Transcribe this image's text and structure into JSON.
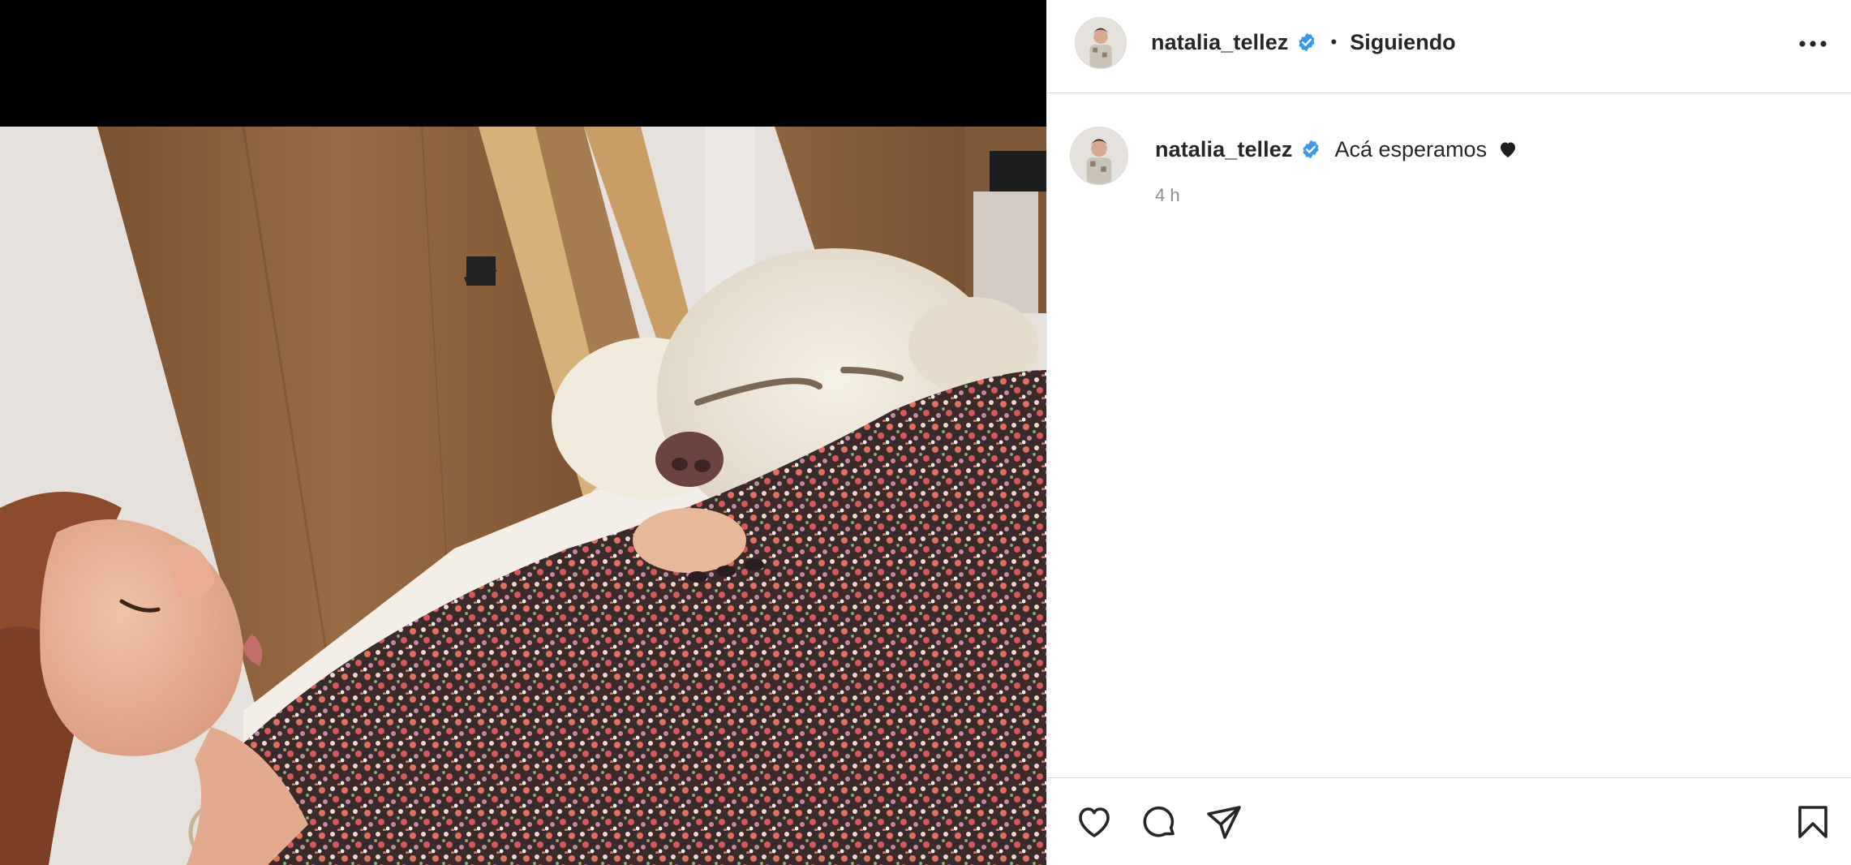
{
  "post": {
    "media": {
      "description_icon": "photo"
    }
  },
  "header": {
    "username": "natalia_tellez",
    "separator": "•",
    "follow_status": "Siguiendo",
    "more_icon": "more-horizontal-icon"
  },
  "caption": {
    "username": "natalia_tellez",
    "text": "Acá esperamos",
    "emoji": "black-heart",
    "timestamp": "4 h"
  },
  "actions": {
    "like_icon": "heart-outline-icon",
    "comment_icon": "comment-bubble-icon",
    "share_icon": "paper-plane-icon",
    "save_icon": "bookmark-icon"
  },
  "colors": {
    "verified_badge": "#3897f0",
    "text_primary": "#262626",
    "text_secondary": "#8e8e8e",
    "divider": "#dbdbdb"
  }
}
